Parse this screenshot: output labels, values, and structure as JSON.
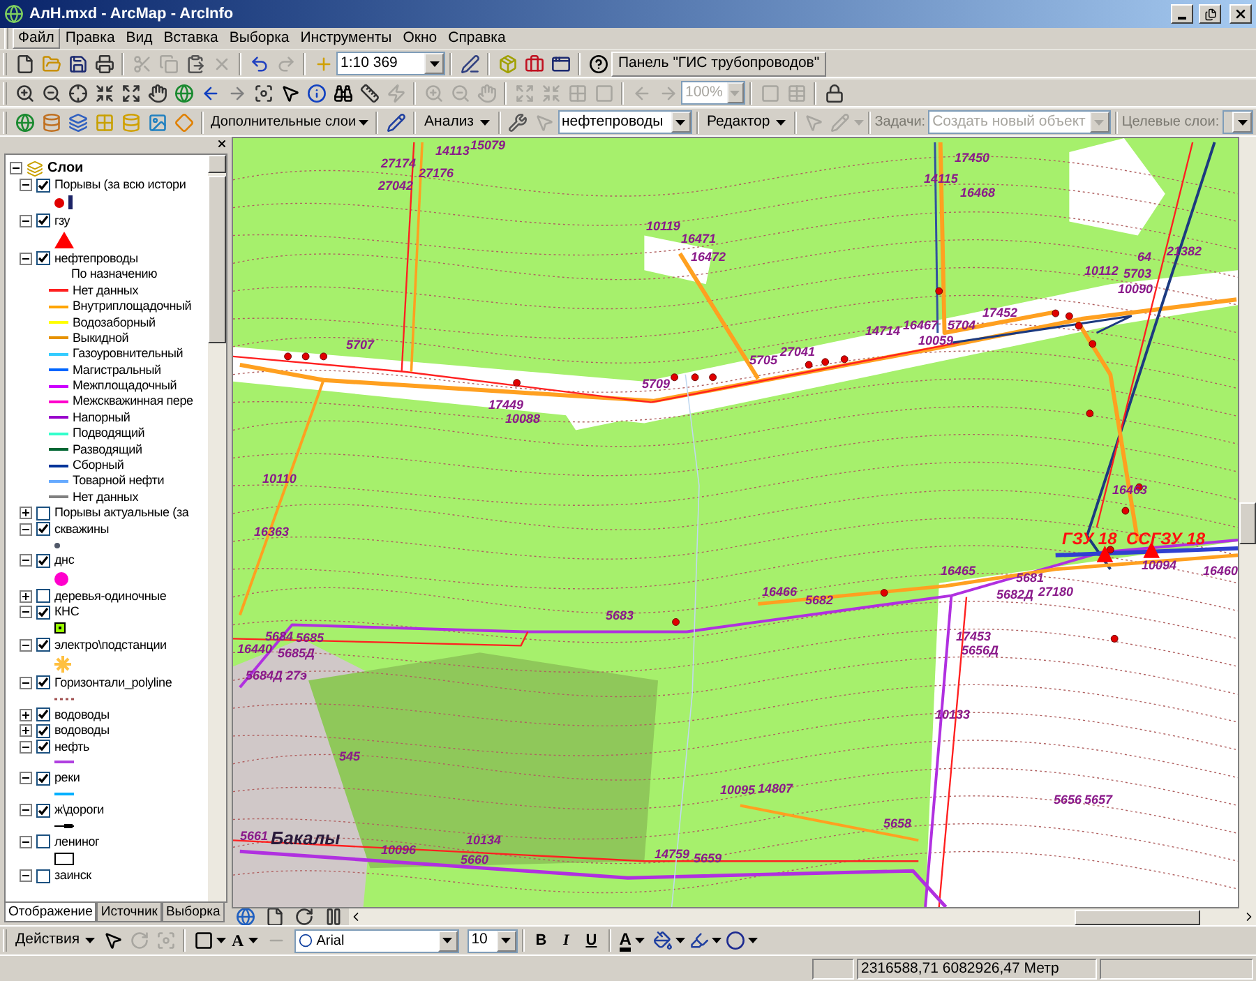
{
  "window": {
    "title": "АлН.mxd - ArcMap - ArcInfo"
  },
  "menu": [
    {
      "label": "Файл",
      "selected": true
    },
    {
      "label": "Правка",
      "selected": false
    },
    {
      "label": "Вид",
      "selected": false
    },
    {
      "label": "Вставка",
      "selected": false
    },
    {
      "label": "Выборка",
      "selected": false
    },
    {
      "label": "Инструменты",
      "selected": false
    },
    {
      "label": "Окно",
      "selected": false
    },
    {
      "label": "Справка",
      "selected": false
    }
  ],
  "standard_toolbar": {
    "scale": "1:10 369",
    "panel_button": "Панель \"ГИС трубопроводов\""
  },
  "layout_toolbar": {
    "zoom_field": "100%",
    "disabled": true
  },
  "tools_toolbar": {
    "extra_layers_menu": "Дополнительные слои",
    "analysis_menu": "Анализ",
    "layer_select": "нефтепроводы"
  },
  "editor_toolbar": {
    "editor_menu": "Редактор",
    "task_label": "Задачи:",
    "task_select": "Создать новый объект",
    "target_label": "Целевые слои:",
    "disabled": true
  },
  "toc": {
    "title": "Слои",
    "expanded": true,
    "layers": [
      {
        "name": "Порывы (за всю истори",
        "checked": true,
        "expanded": true,
        "legend": [
          {
            "symbols": [
              {
                "kind": "dot",
                "color": "#e00000"
              },
              {
                "kind": "bar",
                "color": "#1c2366"
              }
            ]
          }
        ]
      },
      {
        "name": "гзу",
        "checked": true,
        "expanded": true,
        "legend": [
          {
            "symbols": [
              {
                "kind": "triangle",
                "color": "#ff0000"
              }
            ]
          }
        ]
      },
      {
        "name": "нефтепроводы",
        "checked": true,
        "expanded": true,
        "heading": "По назначению",
        "legend": [
          {
            "label": "Нет данных",
            "symbols": [
              {
                "kind": "line",
                "color": "#ff2020"
              }
            ]
          },
          {
            "label": "Внутриплощадочный",
            "symbols": [
              {
                "kind": "line",
                "color": "#ffa500"
              }
            ]
          },
          {
            "label": "Водозаборный",
            "symbols": [
              {
                "kind": "line",
                "color": "#ffff00"
              }
            ]
          },
          {
            "label": "Выкидной",
            "symbols": [
              {
                "kind": "line",
                "color": "#e69200"
              }
            ]
          },
          {
            "label": "Газоуровнительный",
            "symbols": [
              {
                "kind": "line",
                "color": "#33ccff"
              }
            ]
          },
          {
            "label": "Магистральный",
            "symbols": [
              {
                "kind": "line",
                "color": "#0066ff"
              }
            ]
          },
          {
            "label": "Межплощадочный",
            "symbols": [
              {
                "kind": "line",
                "color": "#cc00ff"
              }
            ]
          },
          {
            "label": "Межскважинная пере",
            "symbols": [
              {
                "kind": "line",
                "color": "#ff00cc"
              }
            ]
          },
          {
            "label": "Напорный",
            "symbols": [
              {
                "kind": "line",
                "color": "#9900cc"
              }
            ]
          },
          {
            "label": "Подводящий",
            "symbols": [
              {
                "kind": "line",
                "color": "#33ffcc"
              }
            ]
          },
          {
            "label": "Разводящий",
            "symbols": [
              {
                "kind": "line",
                "color": "#006633"
              }
            ]
          },
          {
            "label": "Сборный",
            "symbols": [
              {
                "kind": "line",
                "color": "#003399"
              }
            ]
          },
          {
            "label": "Товарной нефти",
            "symbols": [
              {
                "kind": "line",
                "color": "#66aaff"
              }
            ]
          },
          {
            "label": "Нет данных",
            "symbols": [
              {
                "kind": "line",
                "color": "#808080"
              }
            ]
          }
        ]
      },
      {
        "name": "Порывы актуальные (за",
        "checked": false,
        "expanded": false
      },
      {
        "name": "скважины",
        "checked": true,
        "expanded": true,
        "legend": [
          {
            "symbols": [
              {
                "kind": "small-dot",
                "color": "#505868"
              }
            ]
          }
        ]
      },
      {
        "name": "днс",
        "checked": true,
        "expanded": true,
        "legend": [
          {
            "symbols": [
              {
                "kind": "big-dot",
                "color": "#ff00cc"
              }
            ]
          }
        ]
      },
      {
        "name": "деревья-одиночные",
        "checked": false,
        "expanded": false
      },
      {
        "name": "КНС",
        "checked": true,
        "expanded": true,
        "legend": [
          {
            "symbols": [
              {
                "kind": "square-dot",
                "color": "#99ff00"
              }
            ]
          }
        ]
      },
      {
        "name": "электро\\подстанции",
        "checked": true,
        "expanded": true,
        "legend": [
          {
            "symbols": [
              {
                "kind": "snowflake",
                "color": "#ffc040"
              }
            ]
          }
        ]
      },
      {
        "name": "Горизонтали_polyline",
        "checked": true,
        "expanded": true,
        "legend": [
          {
            "symbols": [
              {
                "kind": "dotted-line",
                "color": "#a05050"
              }
            ]
          }
        ]
      },
      {
        "name": "водоводы",
        "checked": true,
        "expanded": false
      },
      {
        "name": "водоводы",
        "checked": true,
        "expanded": false
      },
      {
        "name": "нефть",
        "checked": true,
        "expanded": true,
        "legend": [
          {
            "symbols": [
              {
                "kind": "line",
                "color": "#b040e0"
              }
            ]
          }
        ]
      },
      {
        "name": "реки",
        "checked": true,
        "expanded": true,
        "legend": [
          {
            "symbols": [
              {
                "kind": "line",
                "color": "#00b0ff"
              }
            ]
          }
        ]
      },
      {
        "name": "ж\\дороги",
        "checked": true,
        "expanded": true,
        "legend": [
          {
            "symbols": [
              {
                "kind": "rail",
                "color": "#000000"
              }
            ]
          }
        ]
      },
      {
        "name": "лениног",
        "checked": false,
        "expanded": true,
        "legend": [
          {
            "symbols": [
              {
                "kind": "box-outline",
                "color": "#000000"
              }
            ]
          }
        ]
      },
      {
        "name": "заинск",
        "checked": false,
        "expanded": true
      }
    ]
  },
  "toc_tabs": [
    {
      "label": "Отображение",
      "selected": true
    },
    {
      "label": "Источник",
      "selected": false
    },
    {
      "label": "Выборка",
      "selected": false
    }
  ],
  "map": {
    "labels": [
      {
        "text": "15079",
        "kind": "well"
      },
      {
        "text": "14113",
        "kind": "well"
      },
      {
        "text": "27174",
        "kind": "well"
      },
      {
        "text": "27176",
        "kind": "well"
      },
      {
        "text": "27042",
        "kind": "well"
      },
      {
        "text": "17450",
        "kind": "well"
      },
      {
        "text": "14115",
        "kind": "well"
      },
      {
        "text": "16468",
        "kind": "well"
      },
      {
        "text": "10119",
        "kind": "well"
      },
      {
        "text": "16471",
        "kind": "well"
      },
      {
        "text": "16472",
        "kind": "well"
      },
      {
        "text": "64",
        "kind": "well"
      },
      {
        "text": "21382",
        "kind": "well"
      },
      {
        "text": "10112",
        "kind": "well"
      },
      {
        "text": "5703",
        "kind": "well"
      },
      {
        "text": "10090",
        "kind": "well"
      },
      {
        "text": "17452",
        "kind": "well"
      },
      {
        "text": "14714",
        "kind": "well"
      },
      {
        "text": "16467",
        "kind": "well"
      },
      {
        "text": "5704",
        "kind": "well"
      },
      {
        "text": "10059",
        "kind": "well"
      },
      {
        "text": "5707",
        "kind": "well"
      },
      {
        "text": "5705",
        "kind": "well"
      },
      {
        "text": "27041",
        "kind": "well"
      },
      {
        "text": "5709",
        "kind": "well"
      },
      {
        "text": "17449",
        "kind": "well"
      },
      {
        "text": "10088",
        "kind": "well"
      },
      {
        "text": "10110",
        "kind": "well"
      },
      {
        "text": "16463",
        "kind": "well"
      },
      {
        "text": "16363",
        "kind": "well"
      },
      {
        "text": "ГЗУ 18",
        "kind": "facility"
      },
      {
        "text": "ССГЗУ 18",
        "kind": "facility"
      },
      {
        "text": "16465",
        "kind": "well"
      },
      {
        "text": "16466",
        "kind": "well"
      },
      {
        "text": "5682",
        "kind": "well"
      },
      {
        "text": "5681",
        "kind": "well"
      },
      {
        "text": "5682Д",
        "kind": "well"
      },
      {
        "text": "27180",
        "kind": "well"
      },
      {
        "text": "10094",
        "kind": "well"
      },
      {
        "text": "16460",
        "kind": "well"
      },
      {
        "text": "5683",
        "kind": "well"
      },
      {
        "text": "5684",
        "kind": "well"
      },
      {
        "text": "5685",
        "kind": "well"
      },
      {
        "text": "16440",
        "kind": "well"
      },
      {
        "text": "5685Д",
        "kind": "well"
      },
      {
        "text": "5684Д",
        "kind": "well"
      },
      {
        "text": "27э",
        "kind": "well"
      },
      {
        "text": "17453",
        "kind": "well"
      },
      {
        "text": "5656Д",
        "kind": "well"
      },
      {
        "text": "10133",
        "kind": "well"
      },
      {
        "text": "545",
        "kind": "well"
      },
      {
        "text": "10095",
        "kind": "well"
      },
      {
        "text": "14807",
        "kind": "well"
      },
      {
        "text": "5656",
        "kind": "well"
      },
      {
        "text": "5657",
        "kind": "well"
      },
      {
        "text": "5661",
        "kind": "well"
      },
      {
        "text": "Бакалы",
        "kind": "settlement"
      },
      {
        "text": "10134",
        "kind": "well"
      },
      {
        "text": "10096",
        "kind": "well"
      },
      {
        "text": "5660",
        "kind": "well"
      },
      {
        "text": "5658",
        "kind": "well"
      },
      {
        "text": "14759",
        "kind": "well"
      },
      {
        "text": "5659",
        "kind": "well"
      }
    ]
  },
  "draw_toolbar": {
    "actions_menu": "Действия",
    "text_tool": "A",
    "font": "Arial",
    "font_size": "10",
    "bold": "B",
    "italic": "I",
    "underline": "U",
    "font_color": "A"
  },
  "status_bar": {
    "coordinates": "2316588,71 6082926,47 Метр"
  }
}
